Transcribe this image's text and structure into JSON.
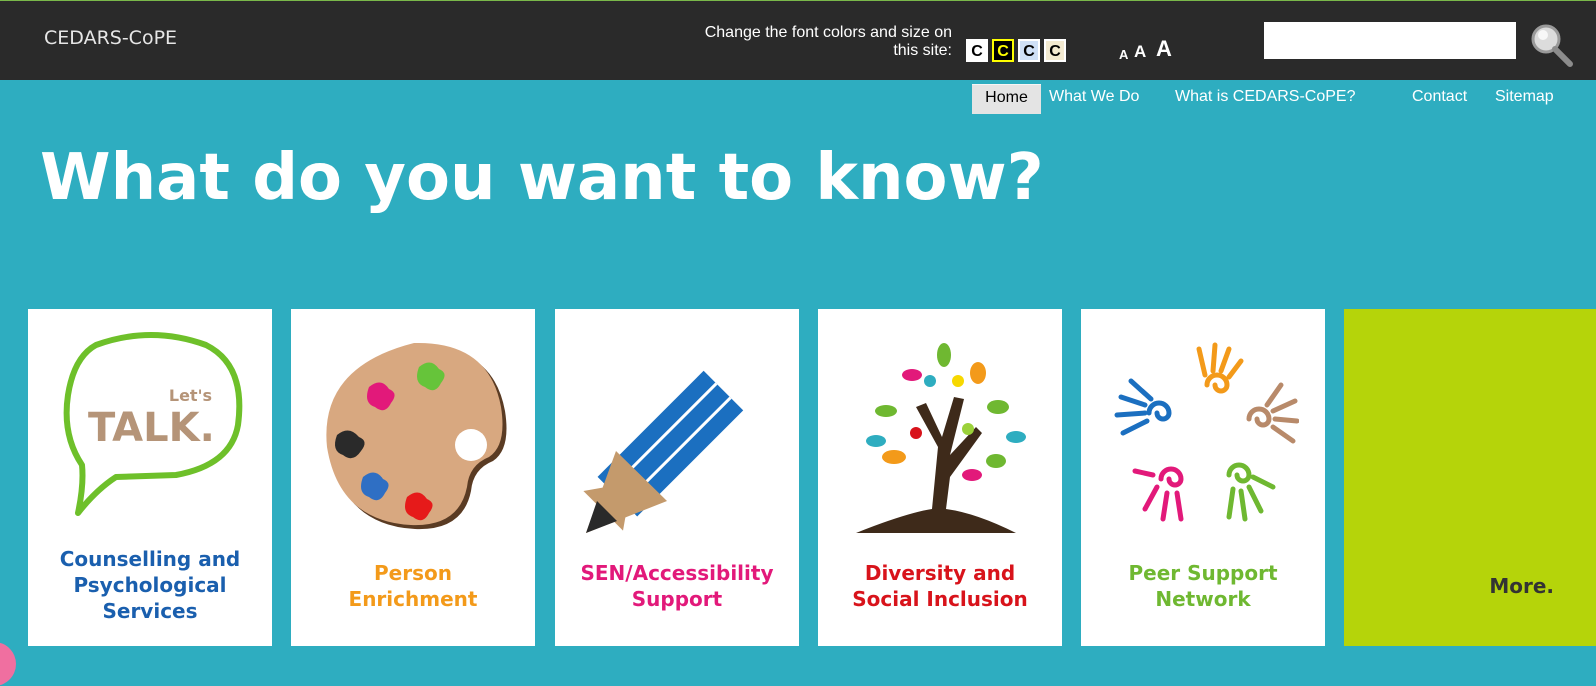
{
  "header": {
    "site_name": "CEDARS-CoPE",
    "font_prompt_line1": "Change the font colors and size on",
    "font_prompt_line2": "this site:",
    "color_options": [
      "C",
      "C",
      "C",
      "C"
    ],
    "size_options": [
      "A",
      "A",
      "A"
    ],
    "search": {
      "value": "",
      "placeholder": ""
    }
  },
  "nav": {
    "items": [
      "Home",
      "What We Do",
      "What is CEDARS-CoPE?",
      "Contact",
      "Sitemap"
    ],
    "active": "Home"
  },
  "main": {
    "headline": "What do you want to know?",
    "cards": [
      {
        "label_lines": [
          "Counselling and",
          "Psychological",
          "Services"
        ],
        "color": "#1a5fae",
        "icon": "lets-talk-speech-bubble-icon",
        "icon_text": [
          "Let's",
          "TALK."
        ]
      },
      {
        "label_lines": [
          "Person",
          "Enrichment"
        ],
        "color": "#f39a1a",
        "icon": "paint-palette-icon"
      },
      {
        "label_lines": [
          "SEN/Accessibility",
          "Support"
        ],
        "color": "#e2197a",
        "icon": "pencil-icon"
      },
      {
        "label_lines": [
          "Diversity and",
          "Social Inclusion"
        ],
        "color": "#d8131b",
        "icon": "tree-icon"
      },
      {
        "label_lines": [
          "Peer Support",
          "Network"
        ],
        "color": "#6fb831",
        "icon": "spiral-hands-icon"
      },
      {
        "label_lines": [
          "More."
        ],
        "color": "#333333",
        "icon": ""
      }
    ]
  },
  "colors": {
    "topbar": "#2a2a2a",
    "background": "#2eadc0",
    "more_card": "#b5d40a"
  }
}
